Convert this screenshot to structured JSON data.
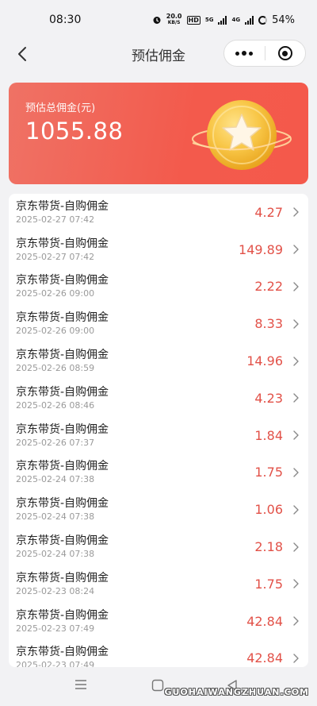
{
  "status_bar": {
    "time": "08:30",
    "net_speed": "20.0",
    "net_unit": "KB/S",
    "hd": "HD",
    "sig1": "5G",
    "sig2": "4G",
    "battery": "54%"
  },
  "nav": {
    "title": "预估佣金"
  },
  "summary": {
    "label": "预估总佣金(元)",
    "amount": "1055.88"
  },
  "records": [
    {
      "title": "京东带货-自购佣金",
      "time": "2025-02-27 07:42",
      "amount": "4.27"
    },
    {
      "title": "京东带货-自购佣金",
      "time": "2025-02-27 07:42",
      "amount": "149.89"
    },
    {
      "title": "京东带货-自购佣金",
      "time": "2025-02-26 09:00",
      "amount": "2.22"
    },
    {
      "title": "京东带货-自购佣金",
      "time": "2025-02-26 09:00",
      "amount": "8.33"
    },
    {
      "title": "京东带货-自购佣金",
      "time": "2025-02-26 08:59",
      "amount": "14.96"
    },
    {
      "title": "京东带货-自购佣金",
      "time": "2025-02-26 08:46",
      "amount": "4.23"
    },
    {
      "title": "京东带货-自购佣金",
      "time": "2025-02-26 07:37",
      "amount": "1.84"
    },
    {
      "title": "京东带货-自购佣金",
      "time": "2025-02-24 07:38",
      "amount": "1.75"
    },
    {
      "title": "京东带货-自购佣金",
      "time": "2025-02-24 07:38",
      "amount": "1.06"
    },
    {
      "title": "京东带货-自购佣金",
      "time": "2025-02-24 07:38",
      "amount": "2.18"
    },
    {
      "title": "京东带货-自购佣金",
      "time": "2025-02-23 08:24",
      "amount": "1.75"
    },
    {
      "title": "京东带货-自购佣金",
      "time": "2025-02-23 07:49",
      "amount": "42.84"
    },
    {
      "title": "京东带货-自购佣金",
      "time": "2025-02-23 07:49",
      "amount": "42.84"
    }
  ],
  "watermark": "GUOHAIWANGZHUAN.COM",
  "colors": {
    "accent": "#f35a4c",
    "amount": "#e25148",
    "coin": "#f7b731"
  }
}
